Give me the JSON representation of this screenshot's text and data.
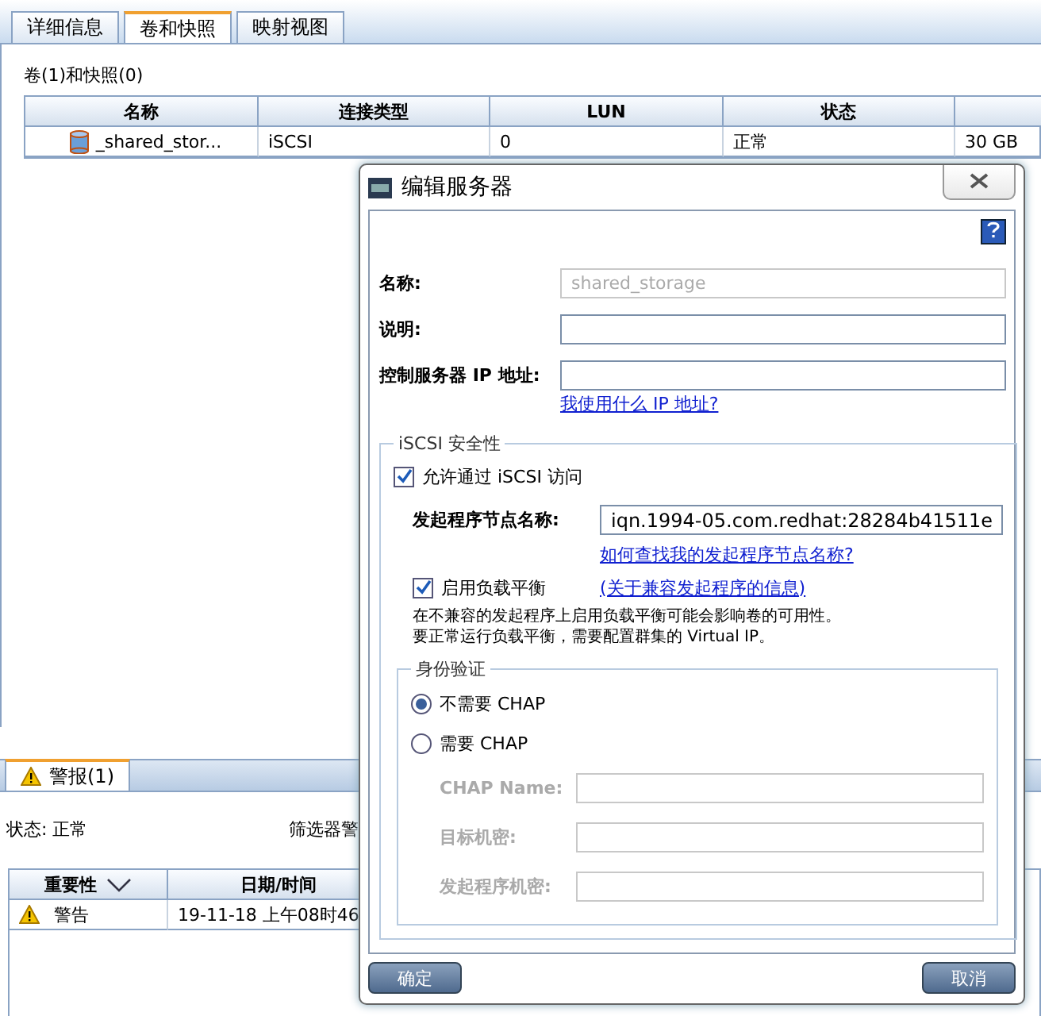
{
  "tabs": [
    {
      "label": "详细信息",
      "selected": false
    },
    {
      "label": "卷和快照",
      "selected": true
    },
    {
      "label": "映射视图",
      "selected": false
    }
  ],
  "volumes": {
    "title": "卷(1)和快照(0)",
    "columns": [
      "名称",
      "连接类型",
      "LUN",
      "状态"
    ],
    "rows": [
      {
        "cells": [
          "_shared_stor...",
          "iSCSI",
          "0",
          "正常",
          "30 GB"
        ]
      }
    ]
  },
  "alerts": {
    "tab": {
      "label": "警报(1)",
      "selected": true
    },
    "status_label": "状态:",
    "status": "正常",
    "filter_label": "筛选器警",
    "columns": [
      "重要性",
      "日期/时间"
    ],
    "rows": [
      {
        "severity": "警告",
        "datetime": "19-11-18 上午08时46"
      }
    ]
  },
  "dialog": {
    "title": "编辑服务器",
    "fields": [
      {
        "label": "名称:",
        "value": "shared_storage",
        "disabled": true
      },
      {
        "label": "说明:",
        "disabled": false
      },
      {
        "label": "控制服务器 IP 地址:",
        "disabled": false
      }
    ],
    "ip_help_link": "我使用什么 IP 地址?",
    "iscsi": {
      "title": "iSCSI 安全性",
      "allow": {
        "label": "允许通过 iSCSI 访问",
        "checked": true
      },
      "initiator_label": "发起程序节点名称:",
      "initiator_value": "iqn.1994-05.com.redhat:28284b41511e",
      "initiator_help_link": "如何查找我的发起程序节点名称?",
      "load_balance": {
        "label": "启用负载平衡",
        "checked": true
      },
      "compat_link": "(关于兼容发起程序的信息)",
      "note": [
        "在不兼容的发起程序上启用负载平衡可能会影响卷的可用性。",
        "要正常运行负载平衡，需要配置群集的 Virtual IP。"
      ]
    },
    "auth": {
      "title": "身份验证",
      "options": [
        {
          "label": "不需要 CHAP",
          "selected": true
        },
        {
          "label": "需要 CHAP",
          "selected": false
        }
      ],
      "fields": [
        {
          "label": "CHAP Name:",
          "disabled": true
        },
        {
          "label": "目标机密:",
          "disabled": true
        },
        {
          "label": "发起程序机密:",
          "disabled": true
        }
      ]
    },
    "buttons": [
      "确定",
      "取消"
    ]
  }
}
